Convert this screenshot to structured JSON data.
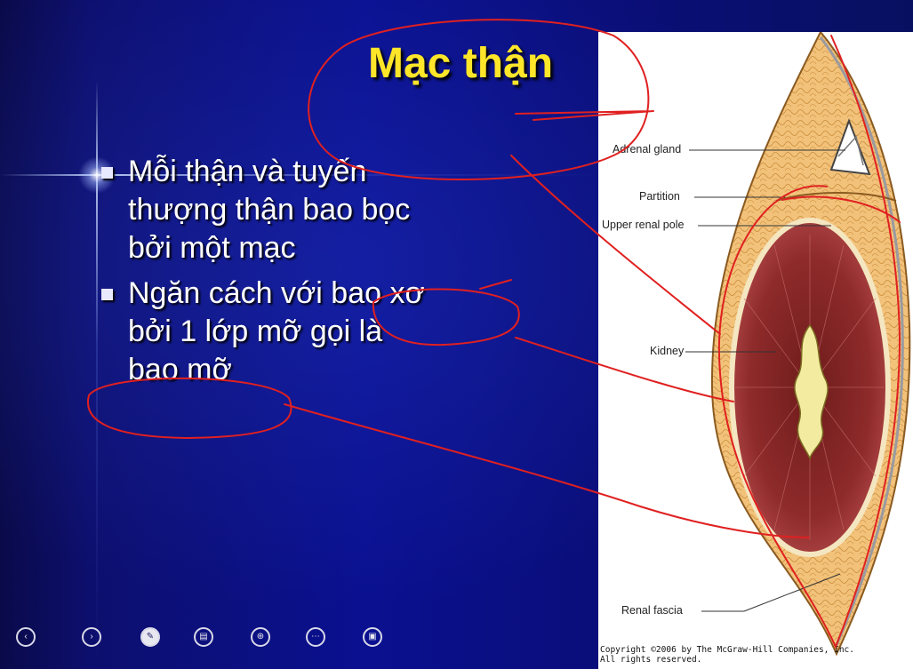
{
  "slide": {
    "title": "Mạc thận",
    "bullets": [
      {
        "text": "Mỗi thận và tuyến\nthượng thận bao bọc\nbởi một mạc"
      },
      {
        "text": "Ngăn cách với bao xơ\nbởi 1 lớp mỡ gọi là\nbao mỡ"
      }
    ]
  },
  "figure": {
    "labels": {
      "adrenal_gland": "Adrenal gland",
      "partition": "Partition",
      "upper_renal_pole": "Upper renal pole",
      "kidney": "Kidney",
      "renal_fascia": "Renal fascia"
    },
    "copyright_line1": "Copyright ©2006 by The McGraw-Hill Companies, Inc.",
    "copyright_line2": "All rights reserved."
  },
  "toolbar": {
    "buttons": [
      {
        "name": "previous-slide-button",
        "icon": "chevron-left-icon",
        "glyph": "‹"
      },
      {
        "name": "next-slide-button",
        "icon": "chevron-right-icon",
        "glyph": "›"
      },
      {
        "name": "pen-button",
        "icon": "pen-icon",
        "glyph": "✎"
      },
      {
        "name": "slides-overview-button",
        "icon": "slides-icon",
        "glyph": "▤"
      },
      {
        "name": "zoom-button",
        "icon": "zoom-icon",
        "glyph": "⊕"
      },
      {
        "name": "more-options-button",
        "icon": "more-icon",
        "glyph": "⋯"
      },
      {
        "name": "presenter-view-button",
        "icon": "presenter-icon",
        "glyph": "▣"
      }
    ]
  },
  "colors": {
    "title": "#ffe629",
    "annotation_ink": "#e02020",
    "fat": "#f2c27a",
    "kidney": "#8e2a2a"
  }
}
